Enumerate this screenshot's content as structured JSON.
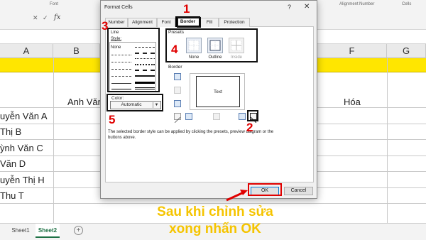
{
  "excel": {
    "ribbon_groups": {
      "font": "Font",
      "alignment": "Alignment",
      "number": "Number",
      "cells": "Cells"
    },
    "formula": {
      "cancel": "✕",
      "enter": "✓",
      "fx": "fx"
    },
    "columns": [
      "A",
      "B",
      "F",
      "G"
    ],
    "header_row": {
      "b": "Anh Văn",
      "f": "Hóa"
    },
    "names": [
      "uyễn Văn A",
      "Thị B",
      "ỳnh Văn C",
      "Văn D",
      "uyễn Thị H",
      "Thu T"
    ],
    "sheets": {
      "sheet1": "Sheet1",
      "sheet2": "Sheet2",
      "add": "+"
    }
  },
  "dialog": {
    "title": "Format Cells",
    "help": "?",
    "close": "✕",
    "tabs": [
      "Number",
      "Alignment",
      "Font",
      "Border",
      "Fill",
      "Protection"
    ],
    "active_tab": "Border",
    "line": {
      "group_label": "Line",
      "style_label": "Style:",
      "none": "None"
    },
    "color": {
      "label": "Color:",
      "value": "Automatic"
    },
    "presets": {
      "label": "Presets",
      "items": [
        "None",
        "Outline",
        "Inside"
      ]
    },
    "border": {
      "label": "Border",
      "preview_text": "Text"
    },
    "info": "The selected border style can be applied by clicking the presets, preview diagram or the buttons above.",
    "ok": "OK",
    "cancel": "Cancel"
  },
  "annotations": {
    "nums": [
      "1",
      "2",
      "3",
      "4",
      "5"
    ],
    "caption_line1": "Sau khi chỉnh sửa",
    "caption_line2": "xong nhấn OK",
    "accent": "#e00000",
    "caption_color": "#f5c400"
  }
}
